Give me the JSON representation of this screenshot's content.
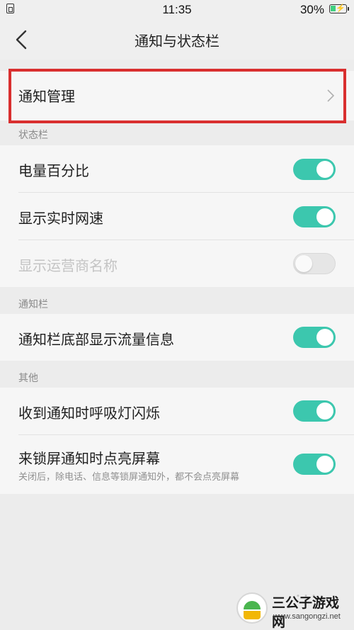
{
  "status_bar": {
    "sim_icon": "sim-card-icon",
    "time": "11:35",
    "battery_percent": "30%",
    "battery_icon": "battery-charging-icon",
    "battery_level": 0.3
  },
  "header": {
    "back_icon": "chevron-left-icon",
    "title": "通知与状态栏"
  },
  "notification_management": {
    "label": "通知管理",
    "chevron_icon": "chevron-right-icon",
    "highlight_color": "#d92f2f"
  },
  "status_bar_section": {
    "header": "状态栏",
    "items": [
      {
        "label": "电量百分比",
        "on": true,
        "enabled": true
      },
      {
        "label": "显示实时网速",
        "on": true,
        "enabled": true
      },
      {
        "label": "显示运营商名称",
        "on": false,
        "enabled": false
      }
    ]
  },
  "notification_bar_section": {
    "header": "通知栏",
    "items": [
      {
        "label": "通知栏底部显示流量信息",
        "on": true,
        "enabled": true
      }
    ]
  },
  "other_section": {
    "header": "其他",
    "items": [
      {
        "label": "收到通知时呼吸灯闪烁",
        "on": true,
        "enabled": true
      },
      {
        "label": "来锁屏通知时点亮屏幕",
        "sub": "关闭后，除电话、信息等锁屏通知外，都不会点亮屏幕",
        "on": true,
        "enabled": true
      }
    ]
  },
  "colors": {
    "toggle_on": "#3cc7ae",
    "toggle_off": "#e6e6e6",
    "background": "#ececec"
  },
  "watermark": {
    "brand": "三公子游戏网",
    "url": "www.sangongzi.net",
    "logo_icon": "android-robot-icon"
  }
}
